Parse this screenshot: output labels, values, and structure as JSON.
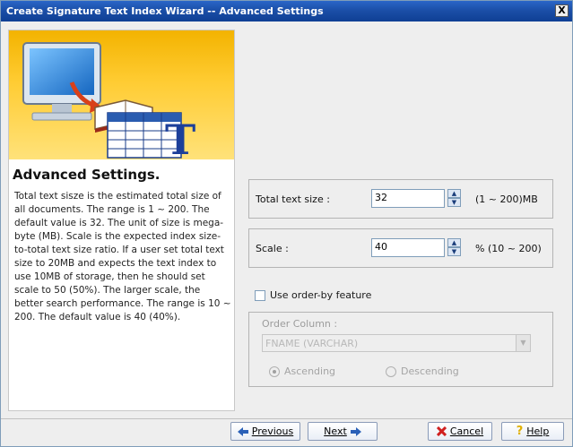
{
  "window": {
    "title": "Create Signature Text Index Wizard -- Advanced Settings",
    "close_label": "X"
  },
  "left": {
    "heading": "Advanced Settings.",
    "description": "Total text sisze is the estimated total size of all documents. The range is 1 ~ 200. The default value is 32. The unit of size is mega-byte (MB). Scale is the expected index size-to-total text size ratio. If a user set total text size to 20MB and expects the text index to use 10MB of storage, then he should set scale to 50 (50%). The larger scale, the better search performance. The range is 10 ~ 200. The default value is 40 (40%)."
  },
  "total_text_size": {
    "label": "Total text size :",
    "value": "32",
    "range": "(1 ~ 200)MB"
  },
  "scale": {
    "label": "Scale :",
    "value": "40",
    "range": "% (10 ~ 200)"
  },
  "order_by": {
    "checkbox_label": "Use order-by feature",
    "checked": false,
    "column_label": "Order Column :",
    "column_value": "FNAME (VARCHAR)",
    "ascending_label": "Ascending",
    "descending_label": "Descending",
    "selected": "Ascending"
  },
  "buttons": {
    "previous": "Previous",
    "next": "Next",
    "cancel": "Cancel",
    "help": "Help"
  },
  "colors": {
    "title_bar": "#1b4fa8",
    "banner": "#ffcc33"
  }
}
